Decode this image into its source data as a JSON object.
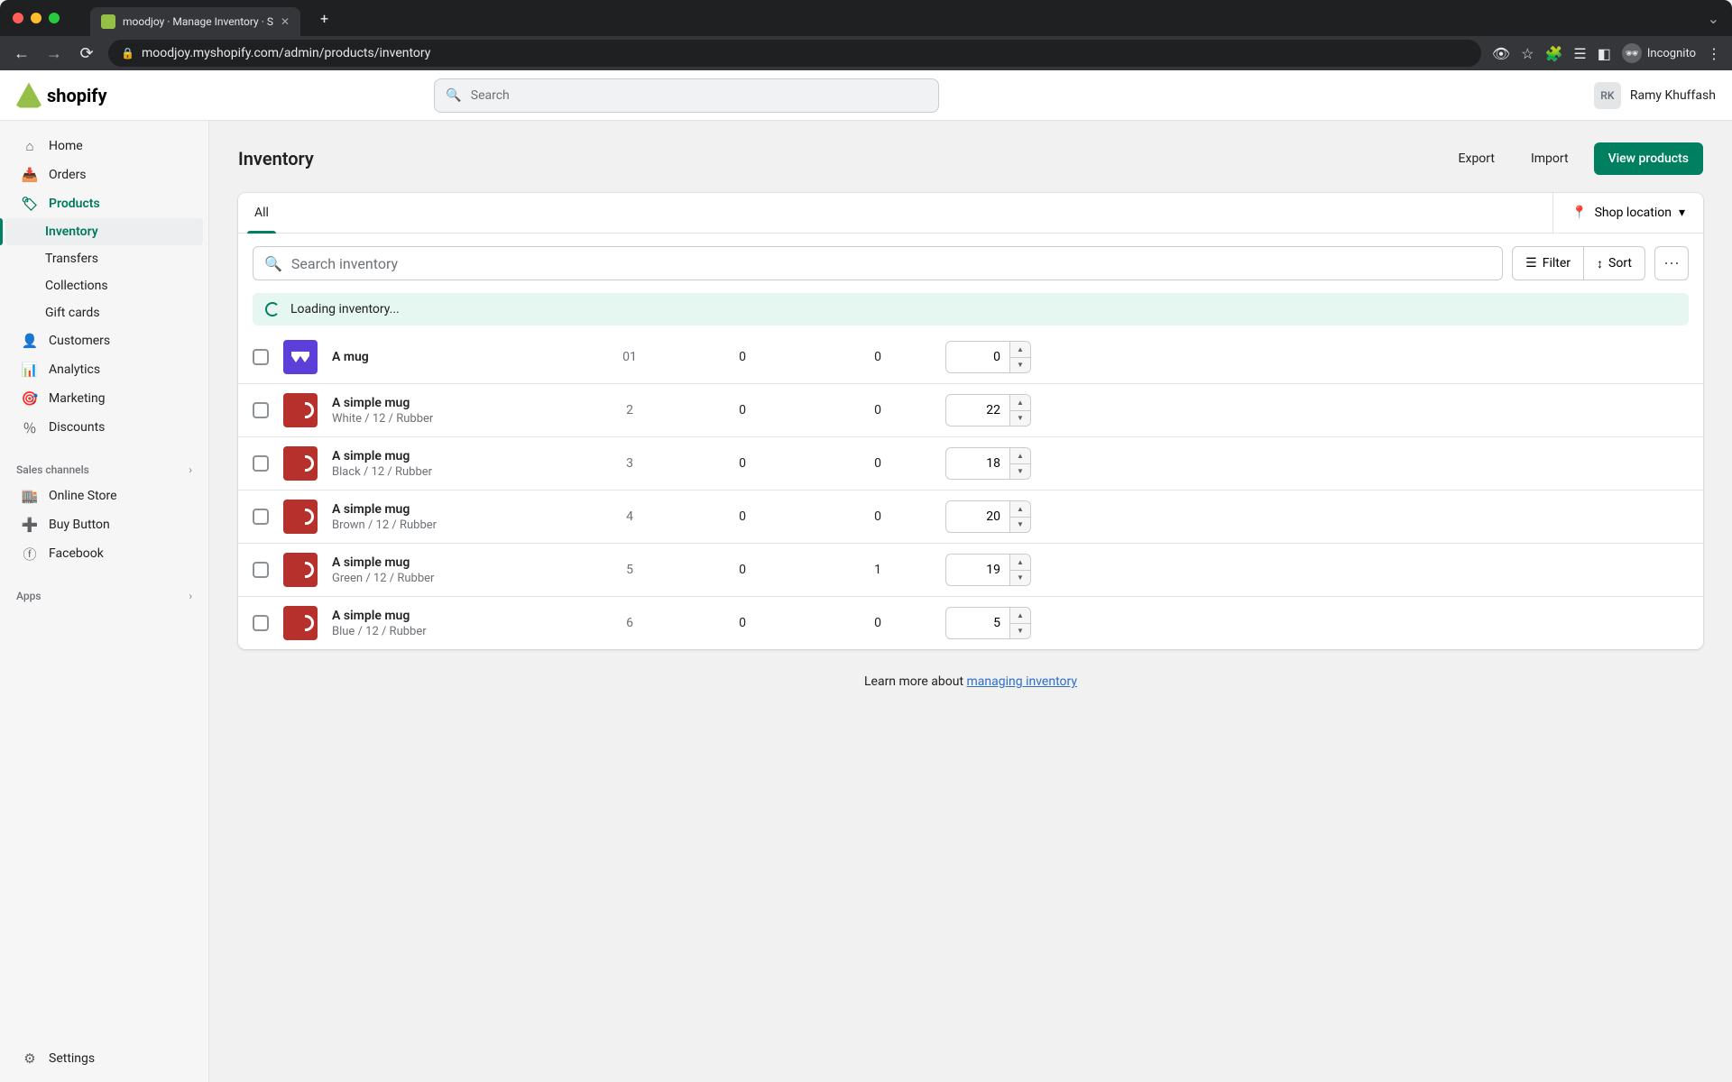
{
  "browser": {
    "tab_title": "moodjoy · Manage Inventory · S",
    "url": "moodjoy.myshopify.com/admin/products/inventory",
    "incognito_label": "Incognito"
  },
  "header": {
    "search_placeholder": "Search",
    "user_initials": "RK",
    "user_name": "Ramy Khuffash"
  },
  "sidebar": {
    "items": [
      {
        "label": "Home"
      },
      {
        "label": "Orders"
      },
      {
        "label": "Products"
      },
      {
        "label": "Inventory"
      },
      {
        "label": "Transfers"
      },
      {
        "label": "Collections"
      },
      {
        "label": "Gift cards"
      },
      {
        "label": "Customers"
      },
      {
        "label": "Analytics"
      },
      {
        "label": "Marketing"
      },
      {
        "label": "Discounts"
      }
    ],
    "section_sales": "Sales channels",
    "channels": [
      {
        "label": "Online Store"
      },
      {
        "label": "Buy Button"
      },
      {
        "label": "Facebook"
      }
    ],
    "section_apps": "Apps",
    "settings": "Settings"
  },
  "page": {
    "title": "Inventory",
    "export": "Export",
    "import": "Import",
    "view_products": "View products",
    "tab_all": "All",
    "location": "Shop location",
    "search_placeholder": "Search inventory",
    "filter": "Filter",
    "sort": "Sort",
    "loading": "Loading inventory...",
    "learn_prefix": "Learn more about ",
    "learn_link": "managing inventory"
  },
  "rows": [
    {
      "name": "A mug",
      "variant": "",
      "sku": "01",
      "incoming": "0",
      "committed": "0",
      "available": "0",
      "purple": true
    },
    {
      "name": "A simple mug",
      "variant": "White / 12 / Rubber",
      "sku": "2",
      "incoming": "0",
      "committed": "0",
      "available": "22"
    },
    {
      "name": "A simple mug",
      "variant": "Black / 12 / Rubber",
      "sku": "3",
      "incoming": "0",
      "committed": "0",
      "available": "18"
    },
    {
      "name": "A simple mug",
      "variant": "Brown / 12 / Rubber",
      "sku": "4",
      "incoming": "0",
      "committed": "0",
      "available": "20"
    },
    {
      "name": "A simple mug",
      "variant": "Green / 12 / Rubber",
      "sku": "5",
      "incoming": "0",
      "committed": "1",
      "available": "19"
    },
    {
      "name": "A simple mug",
      "variant": "Blue / 12 / Rubber",
      "sku": "6",
      "incoming": "0",
      "committed": "0",
      "available": "5"
    }
  ]
}
